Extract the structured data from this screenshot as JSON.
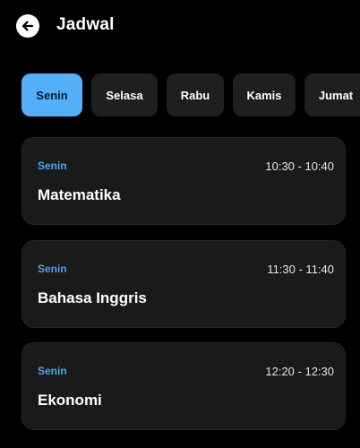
{
  "header": {
    "title": "Jadwal"
  },
  "tabs": [
    {
      "label": "Senin",
      "active": true
    },
    {
      "label": "Selasa",
      "active": false
    },
    {
      "label": "Rabu",
      "active": false
    },
    {
      "label": "Kamis",
      "active": false
    },
    {
      "label": "Jumat",
      "active": false
    }
  ],
  "schedule": [
    {
      "day": "Senin",
      "time": "10:30 - 10:40",
      "subject": "Matematika"
    },
    {
      "day": "Senin",
      "time": "11:30 - 11:40",
      "subject": "Bahasa Inggris"
    },
    {
      "day": "Senin",
      "time": "12:20 - 12:30",
      "subject": "Ekonomi"
    }
  ],
  "colors": {
    "background": "#000000",
    "card": "#1a1a1a",
    "accent": "#55aef8",
    "day_text": "#4ea3f0"
  },
  "icons": {
    "back": "arrow-left-icon"
  }
}
